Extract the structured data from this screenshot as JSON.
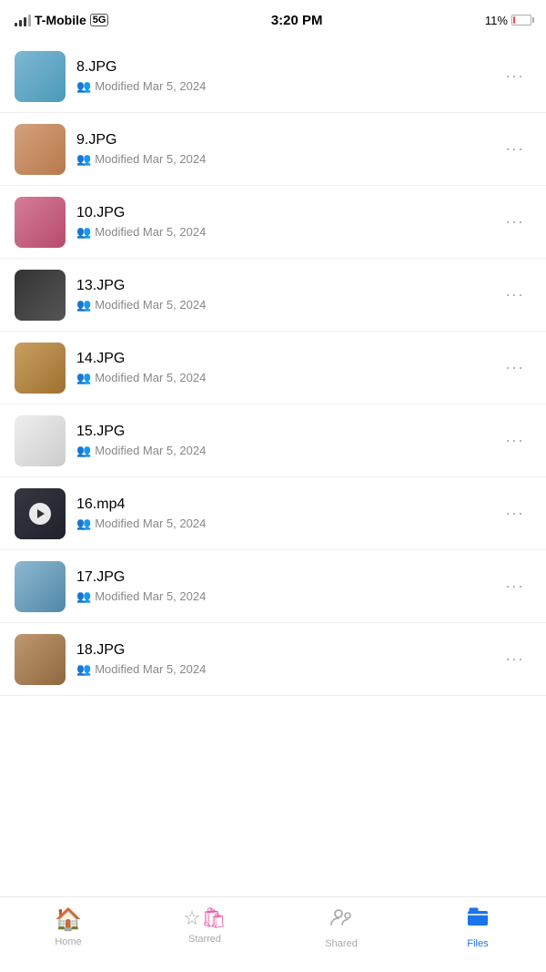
{
  "statusBar": {
    "carrier": "T-Mobile",
    "network": "5G",
    "time": "3:20 PM",
    "battery": "11%"
  },
  "files": [
    {
      "id": "file-8",
      "name": "8.JPG",
      "type": "image",
      "modified": "Modified Mar 5, 2024",
      "thumbClass": "thumb-8"
    },
    {
      "id": "file-9",
      "name": "9.JPG",
      "type": "image",
      "modified": "Modified Mar 5, 2024",
      "thumbClass": "thumb-9"
    },
    {
      "id": "file-10",
      "name": "10.JPG",
      "type": "image",
      "modified": "Modified Mar 5, 2024",
      "thumbClass": "thumb-10"
    },
    {
      "id": "file-13",
      "name": "13.JPG",
      "type": "image",
      "modified": "Modified Mar 5, 2024",
      "thumbClass": "thumb-13"
    },
    {
      "id": "file-14",
      "name": "14.JPG",
      "type": "image",
      "modified": "Modified Mar 5, 2024",
      "thumbClass": "thumb-14"
    },
    {
      "id": "file-15",
      "name": "15.JPG",
      "type": "image",
      "modified": "Modified Mar 5, 2024",
      "thumbClass": "thumb-15"
    },
    {
      "id": "file-16",
      "name": "16.mp4",
      "type": "video",
      "modified": "Modified Mar 5, 2024",
      "thumbClass": "thumb-16"
    },
    {
      "id": "file-17",
      "name": "17.JPG",
      "type": "image",
      "modified": "Modified Mar 5, 2024",
      "thumbClass": "thumb-17"
    },
    {
      "id": "file-18",
      "name": "18.JPG",
      "type": "image",
      "modified": "Modified Mar 5, 2024",
      "thumbClass": "thumb-18"
    }
  ],
  "nav": {
    "items": [
      {
        "id": "home",
        "label": "Home",
        "icon": "🏠",
        "active": false
      },
      {
        "id": "starred",
        "label": "Starred",
        "icon": "☆",
        "active": false,
        "hasHanger": true
      },
      {
        "id": "shared",
        "label": "Shared",
        "icon": "👥",
        "active": false
      },
      {
        "id": "files",
        "label": "Files",
        "icon": "📁",
        "active": true
      }
    ]
  }
}
